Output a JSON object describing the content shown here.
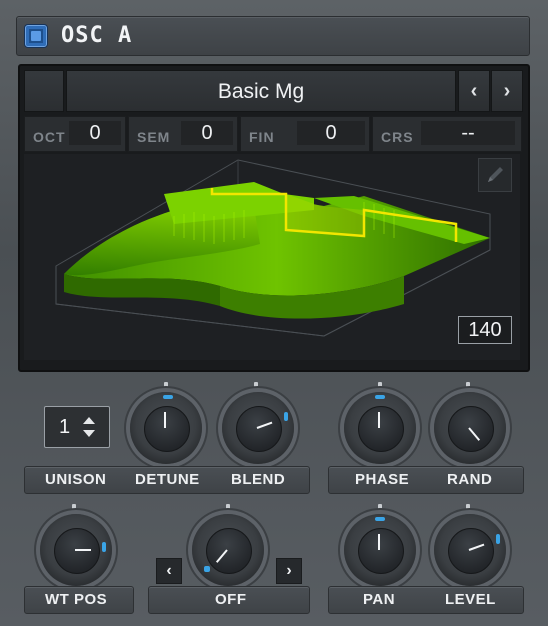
{
  "header": {
    "title": "OSC A",
    "power_state": "on"
  },
  "wavetable": {
    "name": "Basic Mg",
    "prev_icon": "chevron-left-icon",
    "next_icon": "chevron-right-icon",
    "params": [
      {
        "label": "OCT",
        "value": "0"
      },
      {
        "label": "SEM",
        "value": "0"
      },
      {
        "label": "FIN",
        "value": "0"
      },
      {
        "label": "CRS",
        "value": "--"
      }
    ],
    "position": "140",
    "edit_icon": "pencil-icon"
  },
  "unison": {
    "value": "1",
    "label": "UNISON"
  },
  "knobs": {
    "detune": {
      "label": "DETUNE",
      "value": 0.5
    },
    "blend": {
      "label": "BLEND",
      "value": 0.7
    },
    "phase": {
      "label": "PHASE",
      "value": 0.5
    },
    "rand": {
      "label": "RAND",
      "value": 0.0
    },
    "wt_pos": {
      "label": "WT POS",
      "value": 0.75
    },
    "off": {
      "label": "OFF",
      "value": 0.0
    },
    "pan": {
      "label": "PAN",
      "value": 0.5
    },
    "level": {
      "label": "LEVEL",
      "value": 0.7
    }
  },
  "colors": {
    "accent": "#3aa4e6",
    "wave_green": "#7cd200",
    "wave_line": "#f2e600"
  }
}
